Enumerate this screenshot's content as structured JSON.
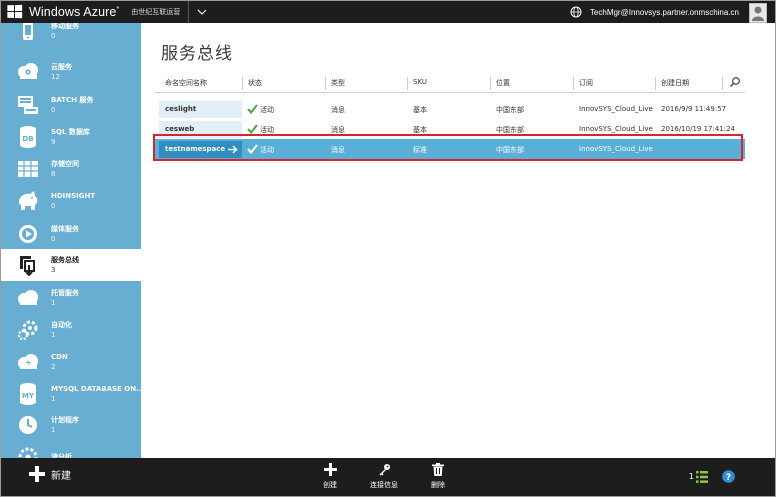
{
  "topbar": {
    "brand": "Windows Azure",
    "brand_mark": "*",
    "operator": "由世纪互联运营",
    "user_email": "TechMgr@Innovsys.partner.onmschina.cn"
  },
  "sidebar": {
    "items": [
      {
        "label": "移动服务",
        "count": "0",
        "icon": "mobile-services-icon"
      },
      {
        "label": "云服务",
        "count": "12",
        "icon": "cloud-services-icon"
      },
      {
        "label": "BATCH 服务",
        "count": "0",
        "icon": "batch-icon"
      },
      {
        "label": "SQL 数据库",
        "count": "9",
        "icon": "sql-database-icon"
      },
      {
        "label": "存储空间",
        "count": "8",
        "icon": "storage-icon"
      },
      {
        "label": "HDINSIGHT",
        "count": "0",
        "icon": "hdinsight-icon"
      },
      {
        "label": "媒体服务",
        "count": "0",
        "icon": "media-services-icon"
      },
      {
        "label": "服务总线",
        "count": "3",
        "icon": "service-bus-icon"
      },
      {
        "label": "托管服务",
        "count": "1",
        "icon": "managed-services-icon"
      },
      {
        "label": "自动化",
        "count": "1",
        "icon": "automation-icon"
      },
      {
        "label": "CDN",
        "count": "2",
        "icon": "cdn-icon"
      },
      {
        "label": "MYSQL DATABASE ON...",
        "count": "1",
        "icon": "mysql-icon"
      },
      {
        "label": "计划程序",
        "count": "1",
        "icon": "scheduler-icon"
      },
      {
        "label": "流分析",
        "count": "",
        "icon": "stream-analytics-icon"
      }
    ]
  },
  "main": {
    "title": "服务总线",
    "columns": [
      "命名空间名称",
      "状态",
      "类型",
      "SKU",
      "位置",
      "订阅",
      "创建日期"
    ],
    "rows": [
      {
        "name": "ceslight",
        "status": "活动",
        "type": "消息",
        "sku": "基本",
        "location": "中国东部",
        "subscription": "InnovSYS_Cloud_Live",
        "created": "2016/9/9 11:49:57",
        "selected": false
      },
      {
        "name": "cesweb",
        "status": "活动",
        "type": "消息",
        "sku": "基本",
        "location": "中国东部",
        "subscription": "InnovSYS_Cloud_Live",
        "created": "2016/10/19 17:41:24",
        "selected": false
      },
      {
        "name": "testnamespace",
        "status": "活动",
        "type": "消息",
        "sku": "标准",
        "location": "中国东部",
        "subscription": "InnovSYS_Cloud_Live",
        "created": "",
        "selected": true
      }
    ]
  },
  "bottombar": {
    "new_label": "新建",
    "commands": [
      {
        "label": "创建",
        "icon": "plus-icon"
      },
      {
        "label": "连接信息",
        "icon": "key-icon"
      },
      {
        "label": "删除",
        "icon": "trash-icon"
      }
    ],
    "count": "1",
    "accent": "#8dc63f",
    "help_color": "#2d8fd5"
  }
}
